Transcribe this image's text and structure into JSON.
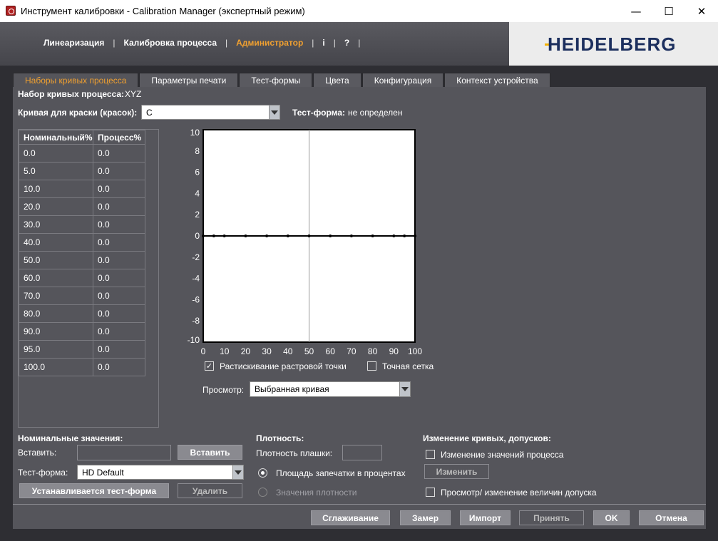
{
  "window": {
    "title": "Инструмент калибровки - Calibration Manager (экспертный режим)",
    "minimize": "—",
    "maximize": "☐",
    "close": "✕"
  },
  "nav": {
    "items": [
      "Линеаризация",
      "Калибровка процесса",
      "Администратор",
      "i",
      "?"
    ],
    "separator": "|",
    "active": "Администратор"
  },
  "logo": {
    "text": "HEIDELBERG",
    "color": "#1c2f5e",
    "accent": "#f3b000"
  },
  "tabs": [
    "Наборы кривых процесса",
    "Параметры печати",
    "Тест-формы",
    "Цвета",
    "Конфигурация",
    "Контекст устройства"
  ],
  "curve_set": {
    "label": "Набор кривых процесса:",
    "value": "XYZ"
  },
  "ink_curve": {
    "label": "Кривая для краски (красок):",
    "value": "C"
  },
  "test_form_info": {
    "label": "Тест-форма:",
    "value": "не определен"
  },
  "table": {
    "headers": [
      "Номинальный%",
      "Процесс%"
    ],
    "rows": [
      [
        "0.0",
        "0.0"
      ],
      [
        "5.0",
        "0.0"
      ],
      [
        "10.0",
        "0.0"
      ],
      [
        "20.0",
        "0.0"
      ],
      [
        "30.0",
        "0.0"
      ],
      [
        "40.0",
        "0.0"
      ],
      [
        "50.0",
        "0.0"
      ],
      [
        "60.0",
        "0.0"
      ],
      [
        "70.0",
        "0.0"
      ],
      [
        "80.0",
        "0.0"
      ],
      [
        "90.0",
        "0.0"
      ],
      [
        "95.0",
        "0.0"
      ],
      [
        "100.0",
        "0.0"
      ]
    ]
  },
  "chart_data": {
    "type": "line",
    "x": [
      0,
      5,
      10,
      20,
      30,
      40,
      50,
      60,
      70,
      80,
      90,
      95,
      100
    ],
    "values": [
      0,
      0,
      0,
      0,
      0,
      0,
      0,
      0,
      0,
      0,
      0,
      0,
      0
    ],
    "xlim": [
      0,
      100
    ],
    "ylim": [
      -10,
      10
    ],
    "x_ticks": [
      "0",
      "10",
      "20",
      "30",
      "40",
      "50",
      "60",
      "70",
      "80",
      "90",
      "100"
    ],
    "y_ticks": [
      "10",
      "8",
      "6",
      "4",
      "2",
      "0",
      "-2",
      "-4",
      "-6",
      "-8",
      "-10"
    ],
    "grid": false,
    "background": "#ffffff"
  },
  "options": {
    "dot_gain": {
      "label": "Растискивание растровой точки",
      "checked": true
    },
    "fine_grid": {
      "label": "Точная сетка",
      "checked": false
    }
  },
  "view": {
    "label": "Просмотр:",
    "value": "Выбранная кривая"
  },
  "nominal": {
    "heading": "Номинальные значения:",
    "insert_label": "Вставить:",
    "insert_button": "Вставить",
    "testform_label": "Тест-форма:",
    "testform_value": "HD Default",
    "set_button": "Устанавливается тест-форма",
    "delete_button": "Удалить"
  },
  "density": {
    "heading": "Плотность:",
    "solid_label": "Плотность плашки:",
    "radio_area": "Площадь запечатки в процентах",
    "radio_density": "Значения плотности"
  },
  "changes": {
    "heading": "Изменение кривых, допусков:",
    "process_label": "Изменение значений процесса",
    "change_button": "Изменить",
    "tolerance_label": "Просмотр/ изменение величин допуска"
  },
  "footer": {
    "smooth": "Сглаживание",
    "measure": "Замер",
    "import": "Импорт",
    "accept": "Принять",
    "ok": "OK",
    "cancel": "Отмена"
  }
}
